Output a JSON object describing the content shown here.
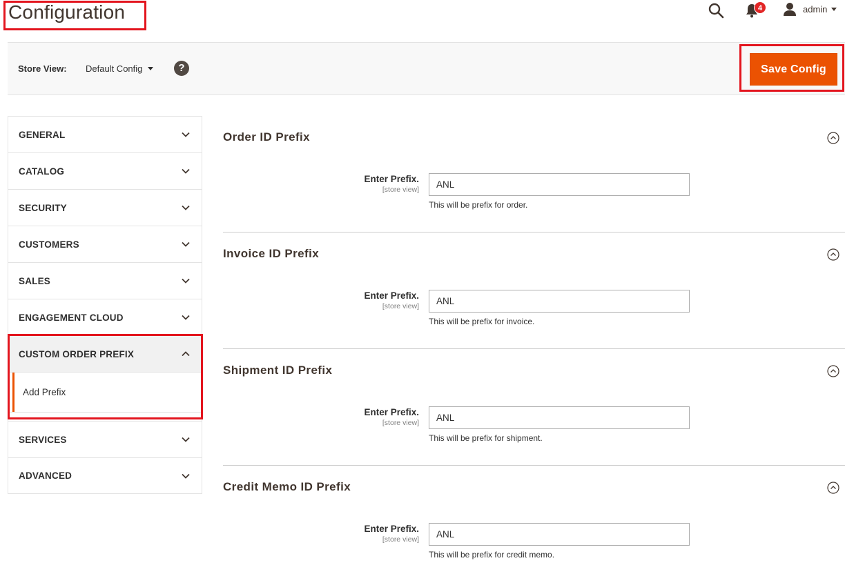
{
  "header": {
    "title": "Configuration",
    "notification_count": "4",
    "user_name": "admin"
  },
  "store_bar": {
    "label": "Store View:",
    "selected": "Default Config",
    "save_label": "Save Config"
  },
  "sidebar": {
    "items": [
      {
        "label": "GENERAL"
      },
      {
        "label": "CATALOG"
      },
      {
        "label": "SECURITY"
      },
      {
        "label": "CUSTOMERS"
      },
      {
        "label": "SALES"
      },
      {
        "label": "ENGAGEMENT CLOUD"
      },
      {
        "label": "CUSTOM ORDER PREFIX"
      },
      {
        "label": "SERVICES"
      },
      {
        "label": "ADVANCED"
      }
    ],
    "sub_item": "Add Prefix"
  },
  "sections": [
    {
      "title": "Order ID Prefix",
      "field_label": "Enter Prefix.",
      "scope": "[store view]",
      "value": "ANL",
      "note": "This will be prefix for order."
    },
    {
      "title": "Invoice ID Prefix",
      "field_label": "Enter Prefix.",
      "scope": "[store view]",
      "value": "ANL",
      "note": "This will be prefix for invoice."
    },
    {
      "title": "Shipment ID Prefix",
      "field_label": "Enter Prefix.",
      "scope": "[store view]",
      "value": "ANL",
      "note": "This will be prefix for shipment."
    },
    {
      "title": "Credit Memo ID Prefix",
      "field_label": "Enter Prefix.",
      "scope": "[store view]",
      "value": "ANL",
      "note": "This will be prefix for credit memo."
    }
  ],
  "colors": {
    "accent": "#eb5202",
    "highlight": "#e3151e",
    "badge": "#e22626"
  }
}
